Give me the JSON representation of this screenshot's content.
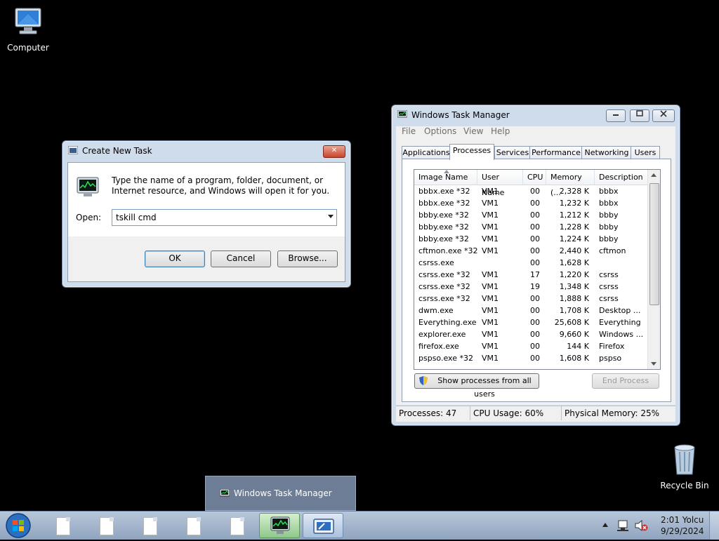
{
  "desktop": {
    "computer_label": "Computer",
    "recycle_label": "Recycle Bin"
  },
  "run_dialog": {
    "title": "Create New Task",
    "message": "Type the name of a program, folder, document, or Internet resource, and Windows will open it for you.",
    "open_label": "Open:",
    "open_value": "tskill cmd",
    "ok": "OK",
    "cancel": "Cancel",
    "browse": "Browse...",
    "close_glyph": "✕"
  },
  "task_manager": {
    "title": "Windows Task Manager",
    "menu": [
      "File",
      "Options",
      "View",
      "Help"
    ],
    "tabs": [
      "Applications",
      "Processes",
      "Services",
      "Performance",
      "Networking",
      "Users"
    ],
    "active_tab": "Processes",
    "columns": [
      "Image Name",
      "User Name",
      "CPU",
      "Memory (...",
      "Description"
    ],
    "rows": [
      {
        "name": "bbbx.exe *32",
        "user": "VM1",
        "cpu": "00",
        "mem": "2,328 K",
        "desc": "bbbx"
      },
      {
        "name": "bbbx.exe *32",
        "user": "VM1",
        "cpu": "00",
        "mem": "1,232 K",
        "desc": "bbbx"
      },
      {
        "name": "bbby.exe *32",
        "user": "VM1",
        "cpu": "00",
        "mem": "1,212 K",
        "desc": "bbby"
      },
      {
        "name": "bbby.exe *32",
        "user": "VM1",
        "cpu": "00",
        "mem": "1,228 K",
        "desc": "bbby"
      },
      {
        "name": "bbby.exe *32",
        "user": "VM1",
        "cpu": "00",
        "mem": "1,224 K",
        "desc": "bbby"
      },
      {
        "name": "cftmon.exe *32",
        "user": "VM1",
        "cpu": "00",
        "mem": "2,440 K",
        "desc": "cftmon"
      },
      {
        "name": "csrss.exe",
        "user": "",
        "cpu": "00",
        "mem": "1,628 K",
        "desc": ""
      },
      {
        "name": "csrss.exe *32",
        "user": "VM1",
        "cpu": "17",
        "mem": "1,220 K",
        "desc": "csrss"
      },
      {
        "name": "csrss.exe *32",
        "user": "VM1",
        "cpu": "19",
        "mem": "1,348 K",
        "desc": "csrss"
      },
      {
        "name": "csrss.exe *32",
        "user": "VM1",
        "cpu": "00",
        "mem": "1,888 K",
        "desc": "csrss"
      },
      {
        "name": "dwm.exe",
        "user": "VM1",
        "cpu": "00",
        "mem": "1,708 K",
        "desc": "Desktop ..."
      },
      {
        "name": "Everything.exe",
        "user": "VM1",
        "cpu": "00",
        "mem": "25,608 K",
        "desc": "Everything"
      },
      {
        "name": "explorer.exe",
        "user": "VM1",
        "cpu": "00",
        "mem": "9,660 K",
        "desc": "Windows ..."
      },
      {
        "name": "firefox.exe",
        "user": "VM1",
        "cpu": "00",
        "mem": "144 K",
        "desc": "Firefox"
      },
      {
        "name": "pspso.exe *32",
        "user": "VM1",
        "cpu": "00",
        "mem": "1,608 K",
        "desc": "pspso"
      }
    ],
    "show_all_button": "Show processes from all users",
    "end_process_button": "End Process",
    "status": {
      "processes": "Processes: 47",
      "cpu": "CPU Usage: 60%",
      "memory": "Physical Memory: 25%"
    }
  },
  "preview": {
    "label": "Windows Task Manager"
  },
  "taskbar": {
    "time": "2:01 Yolcu",
    "date": "9/29/2024"
  }
}
